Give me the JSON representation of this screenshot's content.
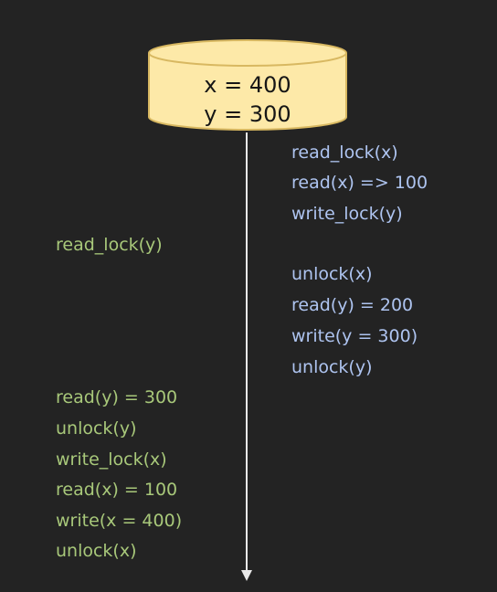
{
  "database": {
    "values": [
      "x = 400",
      "y = 300"
    ]
  },
  "left_operations": [
    "read_lock(y)",
    "read(y) = 300",
    "unlock(y)",
    "write_lock(x)",
    "read(x) = 100",
    "write(x = 400)",
    "unlock(x)"
  ],
  "right_operations": [
    "read_lock(x)",
    "read(x) => 100",
    "write_lock(y)",
    "unlock(x)",
    "read(y) = 200",
    "write(y = 300)",
    "unlock(y)"
  ],
  "colors": {
    "background": "#232323",
    "database_fill": "#fde9a8",
    "database_stroke": "#d8b861",
    "left_text": "#a8c87a",
    "right_text": "#aec4f0",
    "timeline": "#e8e8e8"
  }
}
